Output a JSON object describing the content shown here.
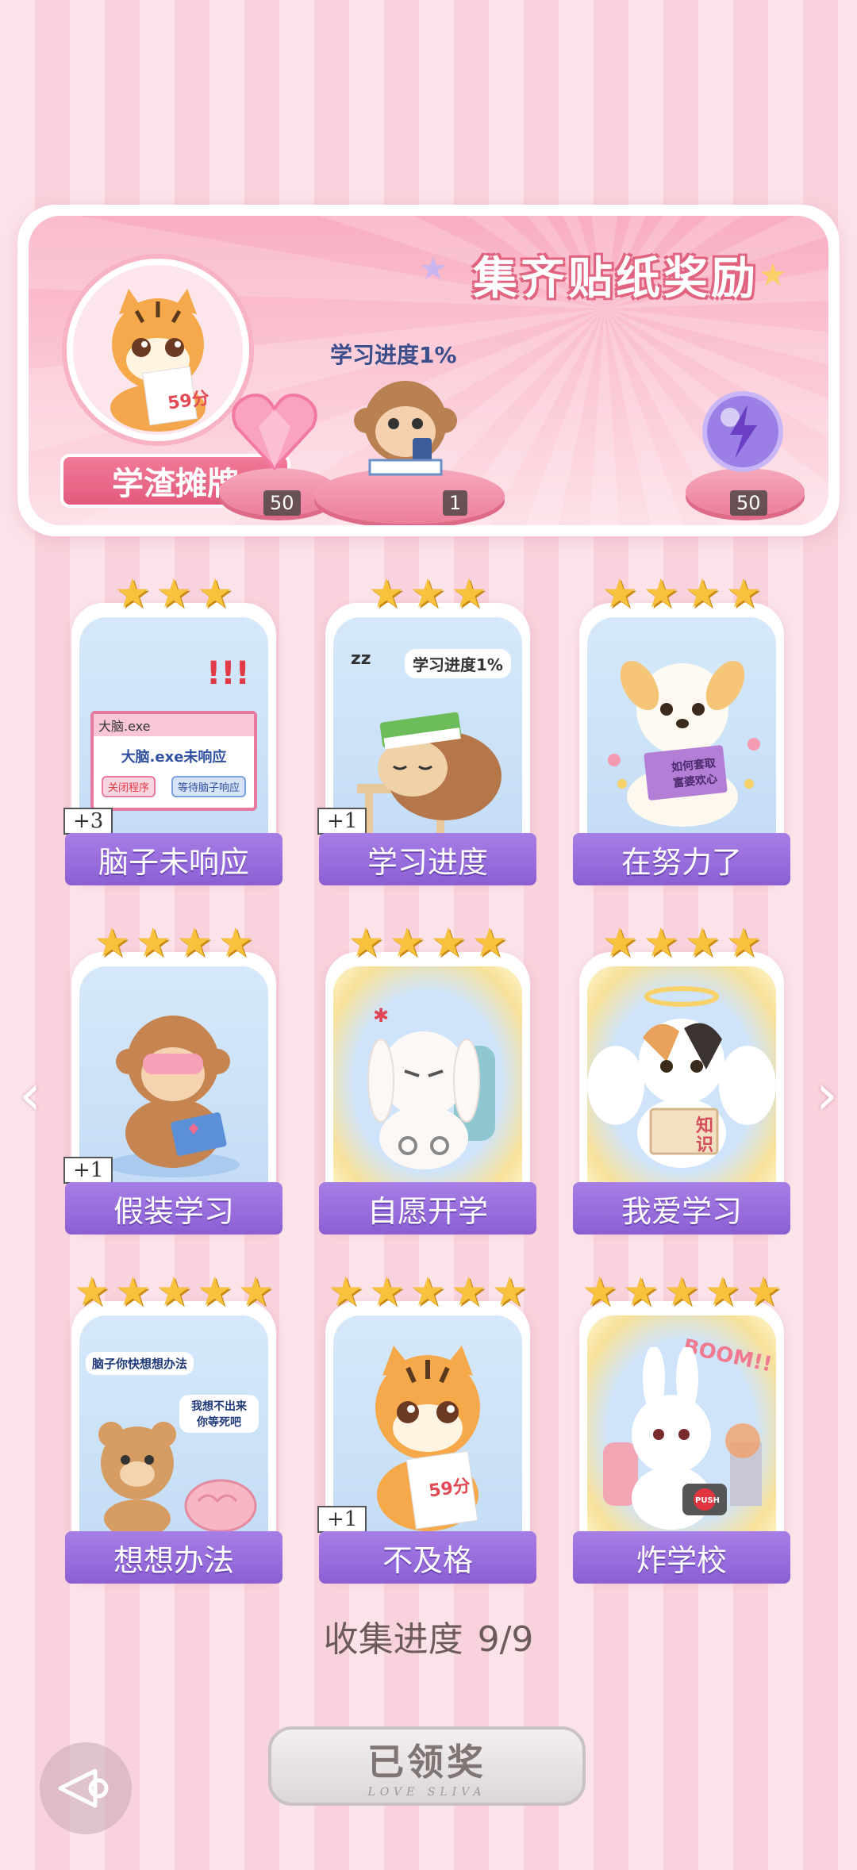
{
  "reward_panel": {
    "title": "集齐贴纸奖励",
    "avatar_label": "学渣摊牌",
    "avatar_note": "59分",
    "progress_text": "学习进度1%",
    "rewards": [
      {
        "icon": "pink-heart-gem-icon",
        "count": "50"
      },
      {
        "icon": "monkey-phone-sticker-icon",
        "count": "1"
      },
      {
        "icon": "purple-lightning-orb-icon",
        "count": "50"
      }
    ]
  },
  "cards": [
    {
      "label": "脑子未响应",
      "stars": 3,
      "badge": "+3",
      "gold": false,
      "art": "brain-not-responding-window",
      "art_title": "大脑.exe",
      "art_text": "大脑.exe未响应",
      "art_btn1": "关闭程序",
      "art_btn2": "等待脑子响应"
    },
    {
      "label": "学习进度",
      "stars": 3,
      "badge": "+1",
      "gold": false,
      "art": "sleeping-sloth-books",
      "art_text": "学习进度1%"
    },
    {
      "label": "在努力了",
      "stars": 4,
      "badge": "",
      "gold": false,
      "art": "puppy-reading",
      "art_text": "如何套取 富婆欢心"
    },
    {
      "label": "假装学习",
      "stars": 4,
      "badge": "+1",
      "gold": false,
      "art": "monkey-reading"
    },
    {
      "label": "自愿开学",
      "stars": 4,
      "badge": "",
      "gold": true,
      "art": "bunny-backpack-cuffs"
    },
    {
      "label": "我爱学习",
      "stars": 4,
      "badge": "",
      "gold": true,
      "art": "angel-cat-book",
      "art_text": "知识"
    },
    {
      "label": "想想办法",
      "stars": 5,
      "badge": "",
      "gold": false,
      "art": "bear-and-brain",
      "art_text": "脑子你快想想办法",
      "art_text2": "我想不出来 你等死吧"
    },
    {
      "label": "不及格",
      "stars": 5,
      "badge": "+1",
      "gold": false,
      "art": "tiger-test-paper",
      "art_text": "59分"
    },
    {
      "label": "炸学校",
      "stars": 5,
      "badge": "",
      "gold": true,
      "art": "bunny-detonator",
      "art_text": "BOOM!!",
      "art_text2": "PUSH"
    }
  ],
  "collect": {
    "label": "收集进度",
    "value": "9/9"
  },
  "claim_button": {
    "label": "已领奖",
    "sub": "LOVE SLIVA"
  },
  "nav": {
    "left_icon": "chevron-left-icon",
    "right_icon": "chevron-right-icon",
    "back_icon": "back-arrow-icon"
  },
  "colors": {
    "banner": "#8b5fd3",
    "star": "#f8c23d",
    "panel_pink": "#f9aec2"
  }
}
